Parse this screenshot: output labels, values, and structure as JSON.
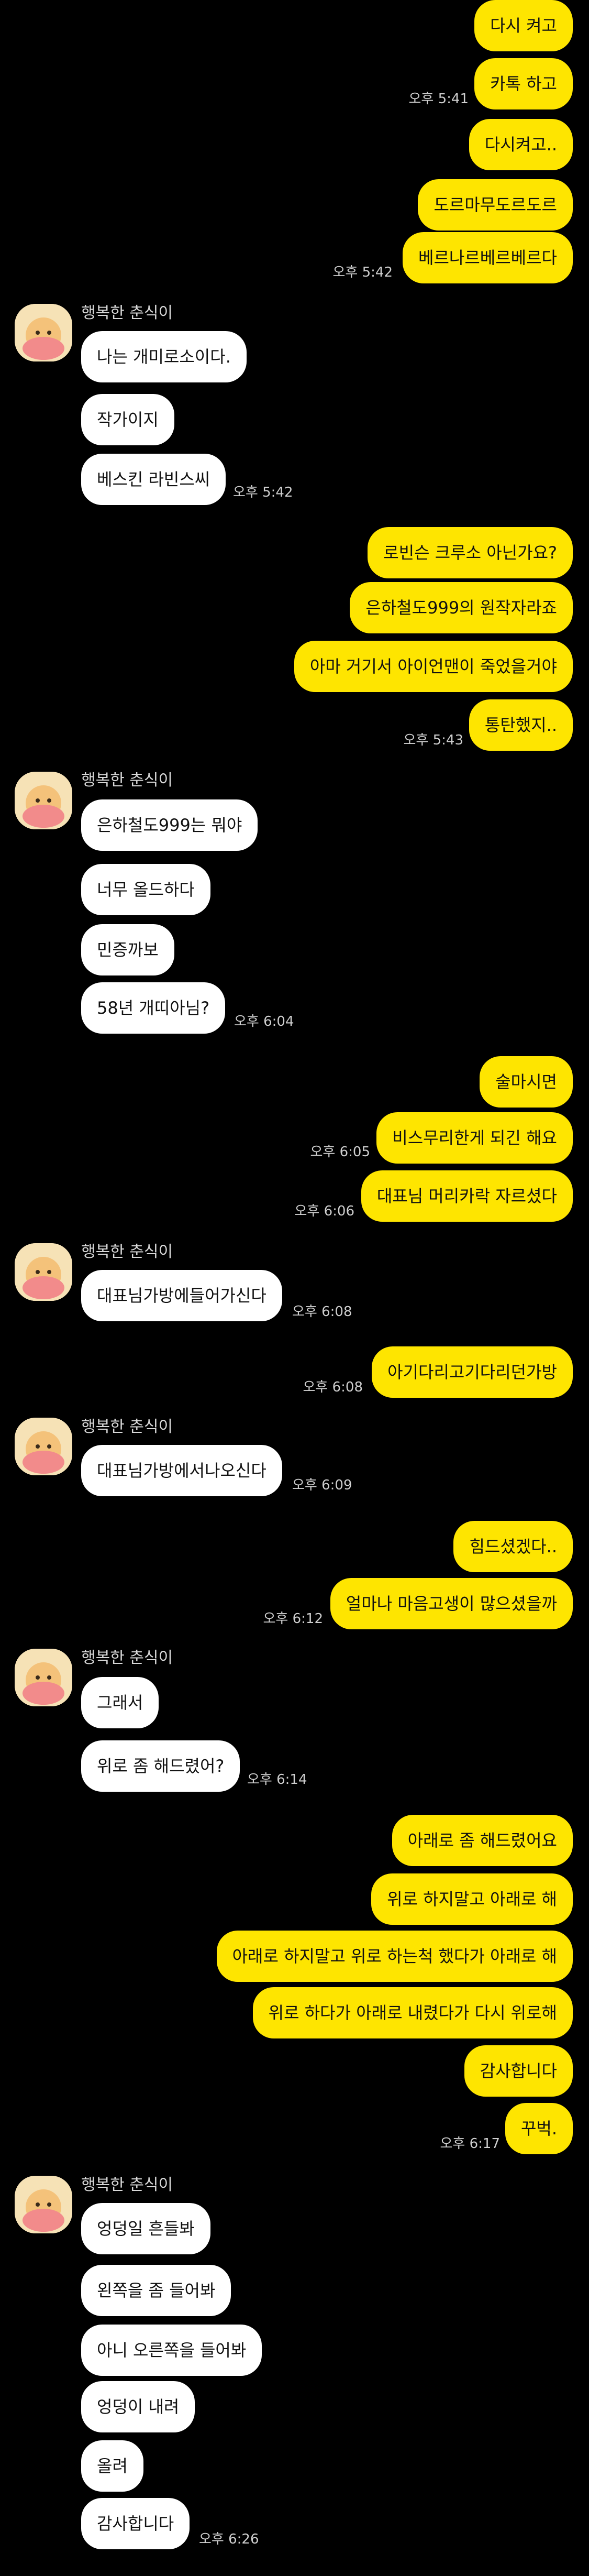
{
  "colors": {
    "background": "#000000",
    "my_bubble": "#FEE500",
    "their_bubble": "#FFFFFF"
  },
  "sender_name": "행복한 춘식이",
  "avatar_icon": "chunsik-character-avatar",
  "messages": [
    {
      "id": "m1",
      "text": "다시 켜고"
    },
    {
      "id": "m2",
      "text": "카톡 하고"
    },
    {
      "id": "m3",
      "text": "다시켜고.."
    },
    {
      "id": "m4",
      "text": "도르마무도르도르"
    },
    {
      "id": "m5",
      "text": "베르나르베르베르다"
    },
    {
      "id": "m6",
      "text": "나는 개미로소이다."
    },
    {
      "id": "m7",
      "text": "작가이지"
    },
    {
      "id": "m8",
      "text": "베스킨 라빈스씨"
    },
    {
      "id": "m9",
      "text": "로빈슨 크루소 아닌가요?"
    },
    {
      "id": "m10",
      "text": "은하철도999의 원작자라죠"
    },
    {
      "id": "m11",
      "text": "아마 거기서 아이언맨이 죽었을거야"
    },
    {
      "id": "m12",
      "text": "통탄했지.."
    },
    {
      "id": "m13",
      "text": "은하철도999는 뭐야"
    },
    {
      "id": "m14",
      "text": "너무 올드하다"
    },
    {
      "id": "m15",
      "text": "민증까보"
    },
    {
      "id": "m16",
      "text": "58년 개띠아님?"
    },
    {
      "id": "m17",
      "text": "술마시면"
    },
    {
      "id": "m18",
      "text": "비스무리한게 되긴 해요"
    },
    {
      "id": "m19",
      "text": "대표님 머리카락 자르셨다"
    },
    {
      "id": "m20",
      "text": "대표님가방에들어가신다"
    },
    {
      "id": "m21",
      "text": "아기다리고기다리던가방"
    },
    {
      "id": "m22",
      "text": "대표님가방에서나오신다"
    },
    {
      "id": "m23",
      "text": "힘드셨겠다.."
    },
    {
      "id": "m24",
      "text": "얼마나 마음고생이 많으셨을까"
    },
    {
      "id": "m25",
      "text": "그래서"
    },
    {
      "id": "m26",
      "text": "위로 좀 해드렸어?"
    },
    {
      "id": "m27",
      "text": "아래로 좀 해드렸어요"
    },
    {
      "id": "m28",
      "text": "위로 하지말고 아래로 해"
    },
    {
      "id": "m29",
      "text": "아래로 하지말고 위로 하는척 했다가 아래로 해"
    },
    {
      "id": "m30",
      "text": "위로 하다가 아래로 내렸다가 다시 위로해"
    },
    {
      "id": "m31",
      "text": "감사합니다"
    },
    {
      "id": "m32",
      "text": "꾸벅."
    },
    {
      "id": "m33",
      "text": "엉덩일 흔들봐"
    },
    {
      "id": "m34",
      "text": "왼쪽을 좀 들어봐"
    },
    {
      "id": "m35",
      "text": "아니 오른쪽을 들어봐"
    },
    {
      "id": "m36",
      "text": "엉덩이 내려"
    },
    {
      "id": "m37",
      "text": "올려"
    },
    {
      "id": "m38",
      "text": "감사합니다"
    }
  ],
  "timestamps": {
    "t1": "오후 5:41",
    "t2": "오후 5:42",
    "t3": "오후 5:42",
    "t4": "오후 5:43",
    "t5": "오후 6:04",
    "t6": "오후 6:05",
    "t7": "오후 6:06",
    "t8": "오후 6:08",
    "t9": "오후 6:08",
    "t10": "오후 6:09",
    "t11": "오후 6:12",
    "t12": "오후 6:14",
    "t13": "오후 6:17",
    "t14": "오후 6:26"
  }
}
